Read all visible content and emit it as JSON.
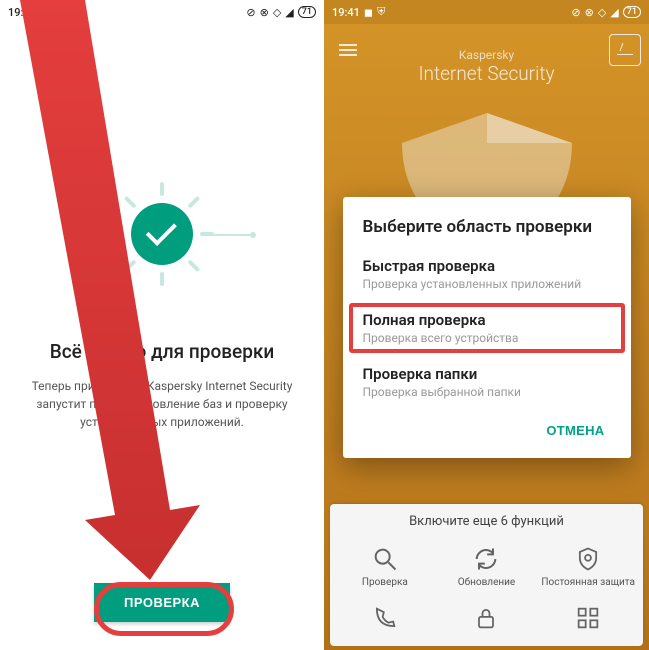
{
  "statusbar": {
    "time": "19:41",
    "battery": "71"
  },
  "left": {
    "title": "Всё готово для проверки",
    "subtitle": "Теперь приложение Kaspersky Internet Security запустит первое обновление баз и проверку установленных приложений.",
    "scan_button": "ПРОВЕРКА"
  },
  "right": {
    "brand_small": "Kaspersky",
    "brand_big": "Internet Security",
    "bottom_title": "Включите еще 6 функций",
    "bottom_items": [
      {
        "label": "Проверка"
      },
      {
        "label": "Обновление"
      },
      {
        "label": "Постоянная защита"
      }
    ],
    "dialog": {
      "title": "Выберите область проверки",
      "options": [
        {
          "title": "Быстрая проверка",
          "sub": "Проверка установленных приложений"
        },
        {
          "title": "Полная проверка",
          "sub": "Проверка всего устройства"
        },
        {
          "title": "Проверка папки",
          "sub": "Проверка выбранной папки"
        }
      ],
      "cancel": "ОТМЕНА"
    }
  }
}
